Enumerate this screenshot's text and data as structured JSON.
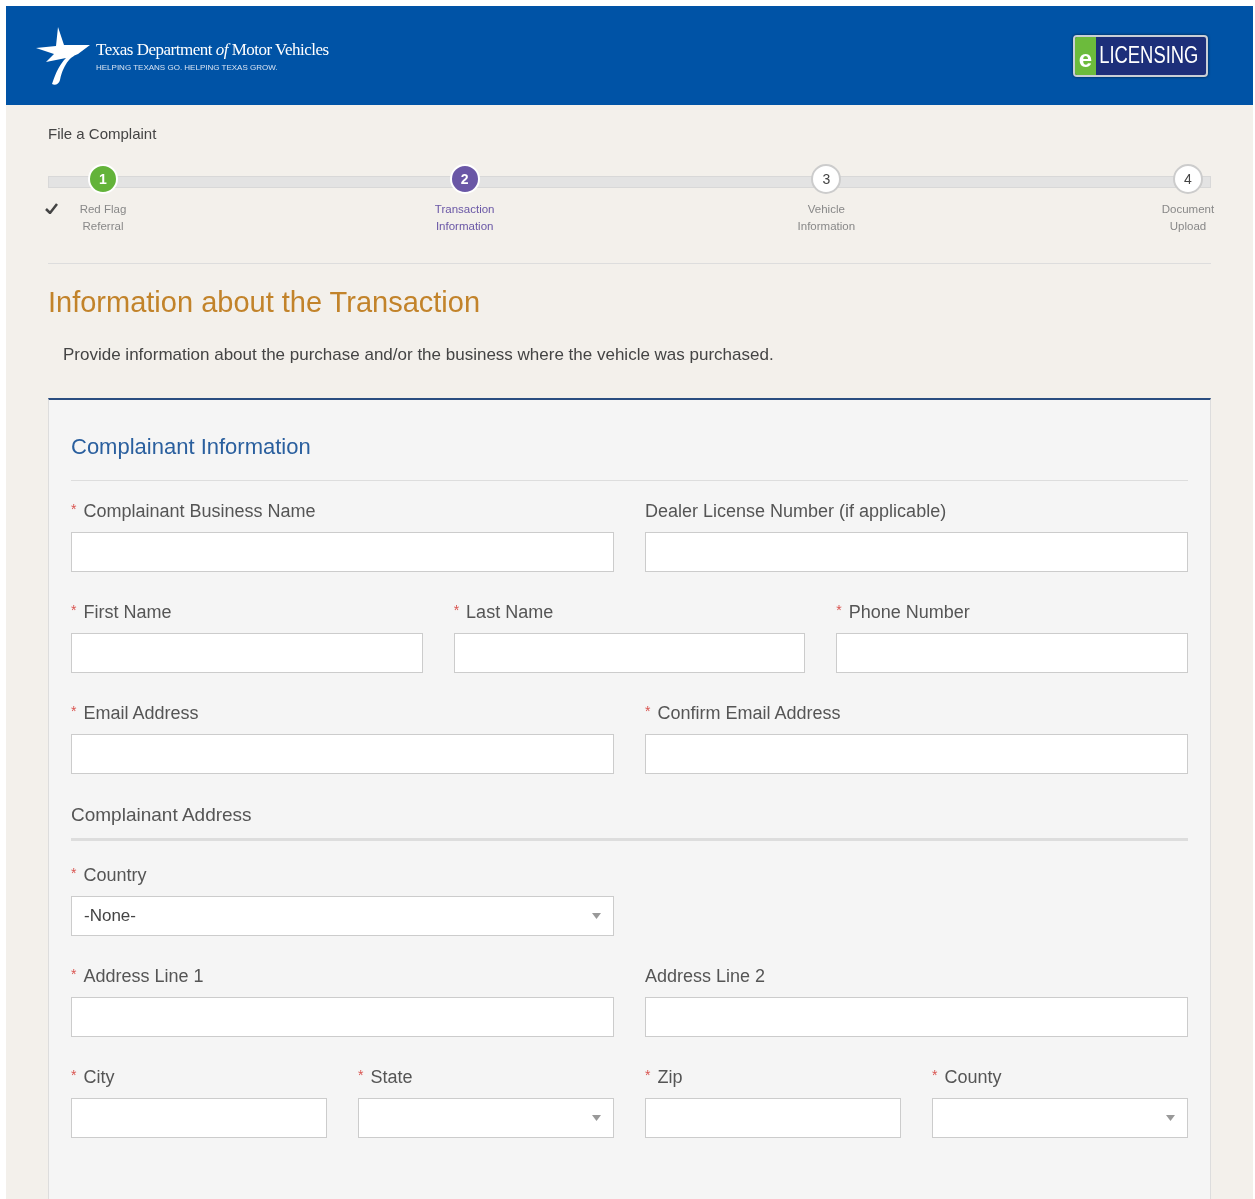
{
  "header": {
    "agency_name": "Texas Department *of* Motor Vehicles",
    "tagline": "HELPING TEXANS GO. HELPING TEXAS GROW.",
    "badge_letter": "e",
    "badge_text": "LICENSING"
  },
  "breadcrumb": "File a Complaint",
  "steps": [
    {
      "number": "1",
      "label": "Red Flag Referral",
      "complete": true,
      "selected": false
    },
    {
      "number": "2",
      "label": "Transaction Information",
      "complete": false,
      "selected": true
    },
    {
      "number": "3",
      "label": "Vehicle Information",
      "complete": false,
      "selected": false
    },
    {
      "number": "4",
      "label": "Document Upload",
      "complete": false,
      "selected": false
    }
  ],
  "page_title": "Information about the Transaction",
  "intro": "Provide information about the purchase and/or the business where the vehicle was purchased.",
  "form": {
    "title": "Complainant Information",
    "rows": [
      {
        "kind": "halves",
        "fields": [
          {
            "label": "Complainant Business Name",
            "required_mark": "*",
            "kind": "text"
          },
          {
            "label": "Dealer License Number (if applicable)",
            "kind": "text"
          }
        ]
      },
      {
        "kind": "thirds",
        "fields": [
          {
            "label": "First Name",
            "required_mark": "*",
            "kind": "text"
          },
          {
            "label": "Last Name",
            "required_mark": "*",
            "kind": "text"
          },
          {
            "label": "Phone Number",
            "required_mark": "*",
            "kind": "text"
          }
        ]
      },
      {
        "kind": "halves",
        "fields": [
          {
            "label": "Email Address",
            "required_mark": "*",
            "kind": "text"
          },
          {
            "label": "Confirm Email Address",
            "required_mark": "*",
            "kind": "text"
          }
        ]
      },
      {
        "kind": "subheading",
        "text": "Complainant Address"
      },
      {
        "kind": "halves",
        "fields": [
          {
            "label": "Country",
            "required_mark": "*",
            "kind": "select",
            "value": "-None-"
          }
        ]
      },
      {
        "kind": "halves",
        "fields": [
          {
            "label": "Address Line 1",
            "required_mark": "*",
            "kind": "text"
          },
          {
            "label": "Address Line 2",
            "kind": "text"
          }
        ]
      },
      {
        "kind": "quarters",
        "fields": [
          {
            "label": "City",
            "required_mark": "*",
            "kind": "text"
          },
          {
            "label": "State",
            "required_mark": "*",
            "kind": "select"
          },
          {
            "label": "Zip",
            "required_mark": "*",
            "kind": "text"
          },
          {
            "label": "County",
            "required_mark": "*",
            "kind": "select"
          }
        ]
      }
    ]
  }
}
